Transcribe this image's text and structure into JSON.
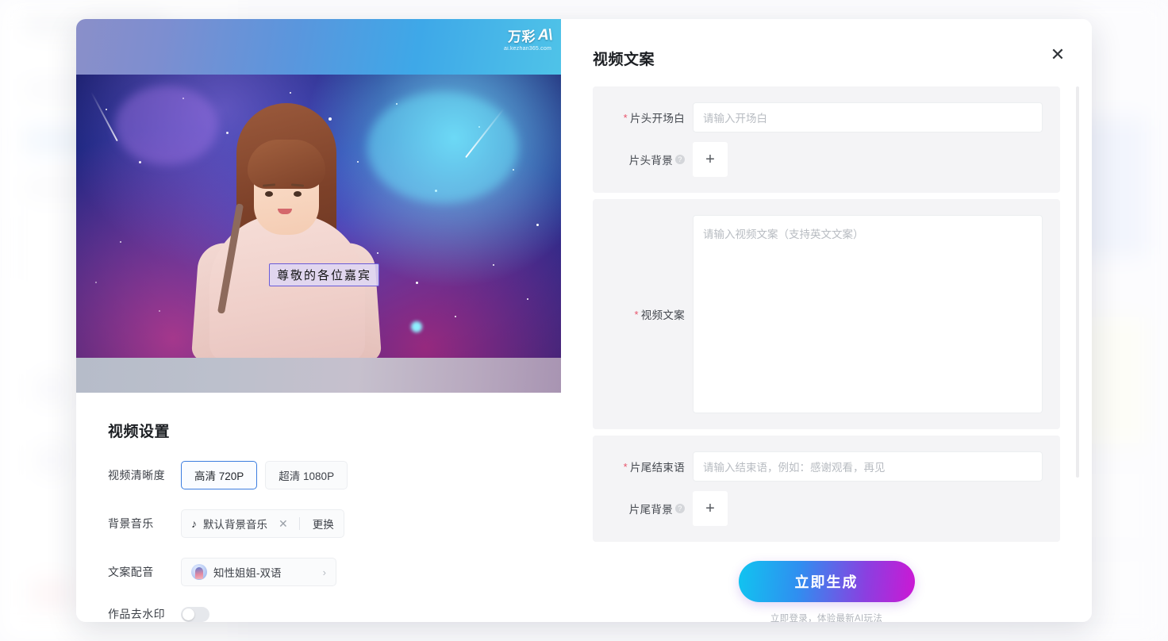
{
  "modal": {
    "left": {
      "preview": {
        "watermark_brand": "万彩",
        "watermark_ai": "A\\",
        "watermark_url": "ai.kezhan365.com",
        "subtitle_text": "尊敬的各位嘉宾"
      },
      "settings": {
        "title": "视频设置",
        "rows": {
          "clarity_label": "视频清晰度",
          "clarity_options": [
            "高清 720P",
            "超清 1080P"
          ],
          "clarity_selected": "高清 720P",
          "music_label": "背景音乐",
          "music_value": "默认背景音乐",
          "music_clear_icon": "close-icon",
          "music_change": "更换",
          "voice_label": "文案配音",
          "voice_value": "知性姐姐-双语",
          "voice_chevron": "›",
          "watermark_label": "作品去水印",
          "watermark_enabled": false
        }
      }
    },
    "right": {
      "title": "视频文案",
      "close_icon": "✕",
      "fields": {
        "opening_label": "片头开场白",
        "opening_required": "*",
        "opening_placeholder": "请输入开场白",
        "opening_value": "",
        "head_bg_label": "片头背景",
        "head_bg_help": "?",
        "head_bg_add": "+",
        "script_label": "视频文案",
        "script_required": "*",
        "script_placeholder": "请输入视频文案（支持英文文案）",
        "script_value": "",
        "ending_label": "片尾结束语",
        "ending_required": "*",
        "ending_placeholder": "请输入结束语，例如：感谢观看，再见",
        "ending_value": "",
        "tail_bg_label": "片尾背景",
        "tail_bg_help": "?",
        "tail_bg_add": "+"
      },
      "cta_label": "立即生成",
      "cta_sub": "立即登录，体验最新AI玩法"
    }
  },
  "colors": {
    "accent_blue": "#3c7ddf",
    "cta_from": "#11c4f0",
    "cta_to": "#cc18d4",
    "required_red": "#e8536b",
    "card_bg": "#f4f4f6"
  }
}
